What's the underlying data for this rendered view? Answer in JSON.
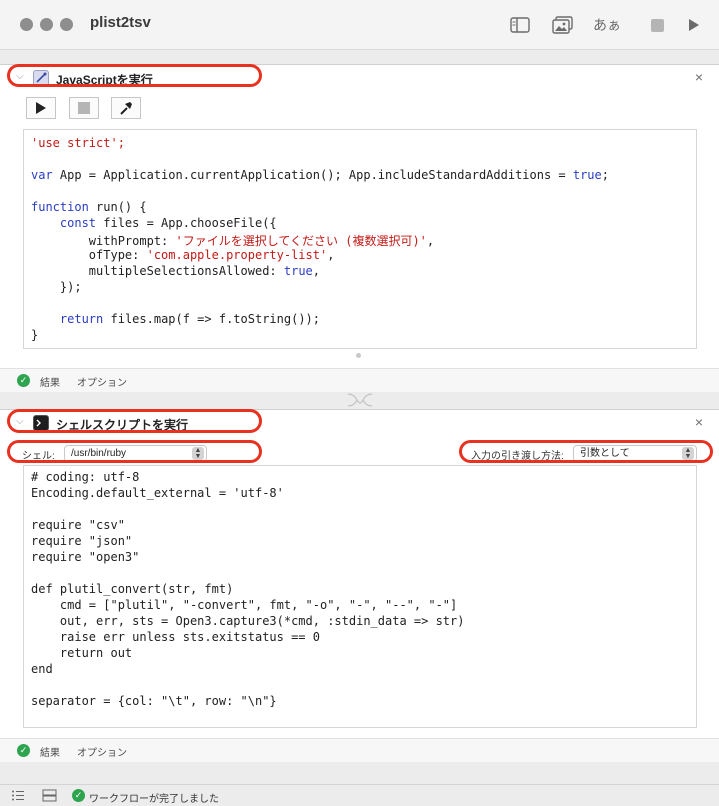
{
  "window": {
    "title": "plist2tsv",
    "toolbar": {
      "text_tool_label": "あぁ"
    }
  },
  "js_action": {
    "title": "JavaScriptを実行",
    "code_lines": [
      "'use strict';",
      "",
      "var App = Application.currentApplication(); App.includeStandardAdditions = true;",
      "",
      "function run() {",
      "    const files = App.chooseFile({",
      "        withPrompt: 'ファイルを選択してください (複数選択可)',",
      "        ofType: 'com.apple.property-list',",
      "        multipleSelectionsAllowed: true,",
      "    });",
      "",
      "    return files.map(f => f.toString());",
      "}"
    ],
    "footer": {
      "results_label": "結果",
      "options_label": "オプション"
    }
  },
  "shell_action": {
    "title": "シェルスクリプトを実行",
    "shell_label": "シェル:",
    "shell_value": "/usr/bin/ruby",
    "input_label": "入力の引き渡し方法:",
    "input_value": "引数として",
    "code_lines": [
      "# coding: utf-8",
      "Encoding.default_external = 'utf-8'",
      "",
      "require \"csv\"",
      "require \"json\"",
      "require \"open3\"",
      "",
      "def plutil_convert(str, fmt)",
      "    cmd = [\"plutil\", \"-convert\", fmt, \"-o\", \"-\", \"--\", \"-\"]",
      "    out, err, sts = Open3.capture3(*cmd, :stdin_data => str)",
      "    raise err unless sts.exitstatus == 0",
      "    return out",
      "end",
      "",
      "separator = {col: \"\\t\", row: \"\\n\"}"
    ],
    "footer": {
      "results_label": "結果",
      "options_label": "オプション"
    }
  },
  "status": {
    "message": "ワークフローが完了しました"
  },
  "colors": {
    "highlight_ring": "#e8321f",
    "success": "#2ea44f",
    "keyword": "#2a3ec0",
    "string": "#c41a16"
  }
}
